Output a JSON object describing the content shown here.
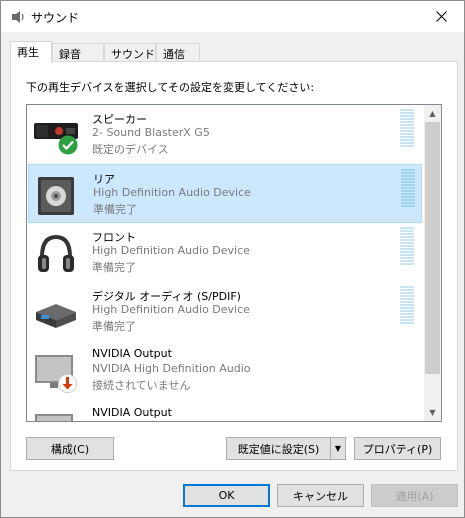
{
  "window": {
    "title": "サウンド",
    "close_icon": "close-icon"
  },
  "tabs": [
    {
      "label": "再生",
      "active": true
    },
    {
      "label": "録音",
      "active": false
    },
    {
      "label": "サウンド",
      "active": false
    },
    {
      "label": "通信",
      "active": false
    }
  ],
  "instruction": "下の再生デバイスを選択してその設定を変更してください:",
  "devices": [
    {
      "name": "スピーカー",
      "line2": "2- Sound BlasterX G5",
      "line3": "既定のデバイス",
      "icon": "soundblaster-device-icon",
      "badge": "default-check-icon",
      "selected": false
    },
    {
      "name": "リア",
      "line2": "High Definition Audio Device",
      "line3": "準備完了",
      "icon": "speaker-icon",
      "selected": true
    },
    {
      "name": "フロント",
      "line2": "High Definition Audio Device",
      "line3": "準備完了",
      "icon": "headphones-icon",
      "selected": false
    },
    {
      "name": "デジタル オーディオ (S/PDIF)",
      "line2": "High Definition Audio Device",
      "line3": "準備完了",
      "icon": "digital-audio-icon",
      "selected": false
    },
    {
      "name": "NVIDIA Output",
      "line2": "NVIDIA High Definition Audio",
      "line3": "接続されていません",
      "icon": "monitor-icon",
      "badge": "disconnected-icon",
      "selected": false
    },
    {
      "name": "NVIDIA Output",
      "line2": "",
      "line3": "",
      "icon": "monitor-icon",
      "selected": false
    }
  ],
  "buttons": {
    "configure": "構成(C)",
    "set_default": "既定値に設定(S)",
    "properties": "プロパティ(P)",
    "ok": "OK",
    "cancel": "キャンセル",
    "apply": "適用(A)"
  },
  "colors": {
    "selection": "#cce8ff",
    "default_button_border": "#0078d7",
    "check_green": "#2ea043",
    "disconnect_red": "#d83b01"
  }
}
